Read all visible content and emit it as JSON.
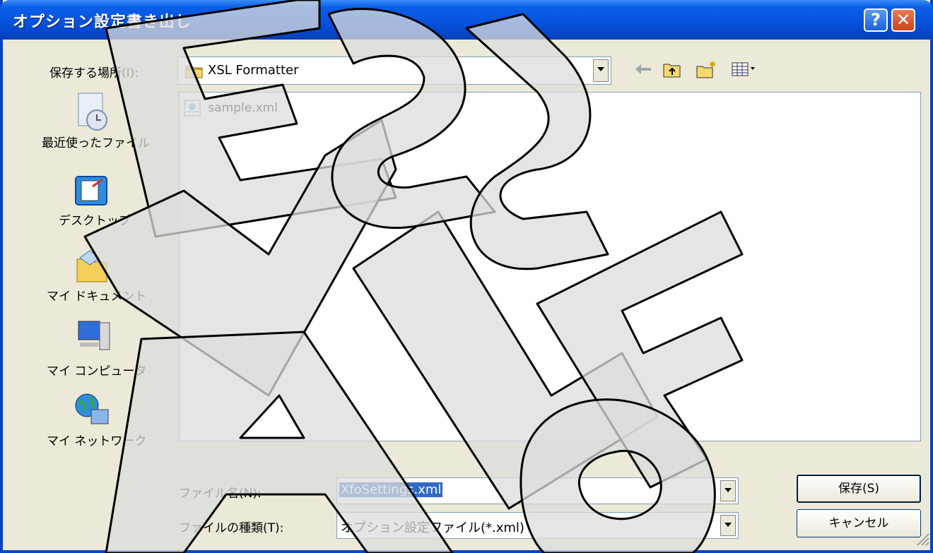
{
  "window": {
    "title": "オプション設定書き出し",
    "help_label": "?",
    "close_label": "✕"
  },
  "location": {
    "label": "保存する場所(I):",
    "value": "XSL Formatter"
  },
  "places": [
    {
      "label": "最近使ったファイル",
      "icon": "recent-files-icon"
    },
    {
      "label": "デスクトップ",
      "icon": "desktop-icon"
    },
    {
      "label": "マイ ドキュメント",
      "icon": "my-documents-icon"
    },
    {
      "label": "マイ コンピュータ",
      "icon": "my-computer-icon"
    },
    {
      "label": "マイ ネットワーク",
      "icon": "my-network-icon"
    }
  ],
  "files": [
    {
      "name": "sample.xml",
      "icon": "xml-file-icon"
    }
  ],
  "filename": {
    "label": "ファイル名(N):",
    "value": "XfoSettings.xml"
  },
  "filetype": {
    "label": "ファイルの種類(T):",
    "value": "オプション設定ファイル(*.xml)"
  },
  "buttons": {
    "save": "保存(S)",
    "cancel": "キャンセル"
  },
  "watermark": "EVAL XSLFO",
  "colors": {
    "titlebar": "#0753dd",
    "dialog_bg": "#ece9d8",
    "selection": "#316ac5"
  }
}
